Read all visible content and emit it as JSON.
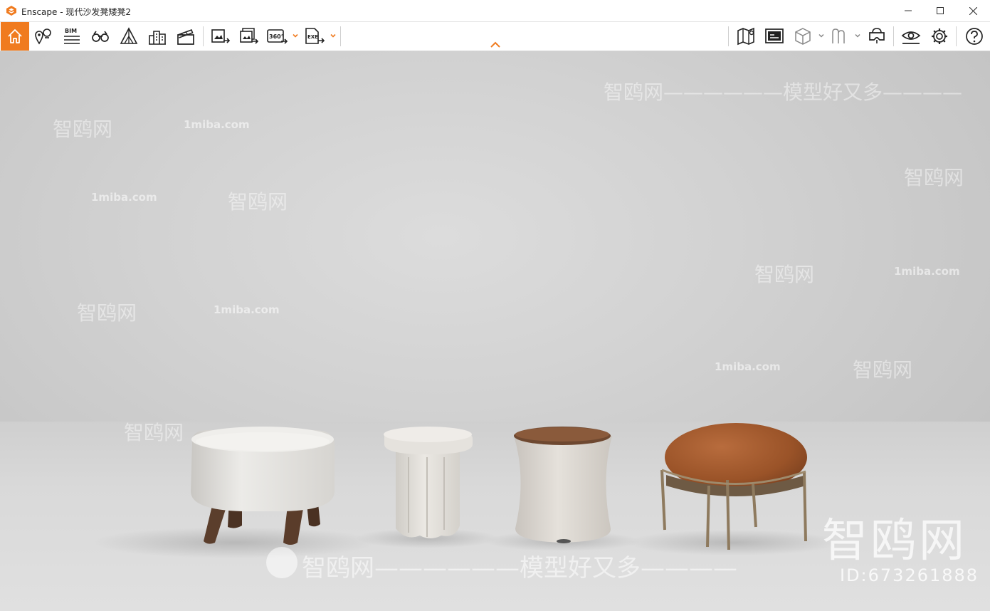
{
  "window": {
    "title": "Enscape - 现代沙发凳矮凳2",
    "accent": "#f07b1f"
  },
  "toolbar": {
    "left_icons": [
      "home-icon",
      "location-icon",
      "bim-icon",
      "binoculars-icon",
      "perspective-icon",
      "buildings-icon",
      "clapper-icon",
      "render-image-icon",
      "batch-render-icon",
      "render-360-icon",
      "export-exe-icon"
    ],
    "right_icons": [
      "map-icon",
      "minimap-icon",
      "cube-icon",
      "walk-icon",
      "vr-headset-icon",
      "visual-settings-icon",
      "settings-icon",
      "help-icon"
    ],
    "bim_label": "BIM",
    "pano_label": "360°",
    "exe_label": "EXE"
  },
  "watermarks": {
    "site": "1miba.com",
    "brand": "智鸥网",
    "slogan": "智鸥网——————模型好又多————",
    "slogan_top": "智鸥网——————模型好又多————",
    "line1": "——————  智鸥网  ——————",
    "logo_text": "智鸥网",
    "id_text": "ID:673261888"
  },
  "scene": {
    "stools": [
      "white-round-stool",
      "boucle-leg-stool",
      "hourglass-stool",
      "orange-frame-ottoman"
    ],
    "colors": {
      "background": "#d2d2d2",
      "white_fabric": "#e9e7e3",
      "wood_legs": "#5b3e2c",
      "boucle": "#e4e1dc",
      "leather_top": "#8a5a3b",
      "orange_fabric": "#a75d31",
      "brass": "#8e7a5e"
    }
  }
}
